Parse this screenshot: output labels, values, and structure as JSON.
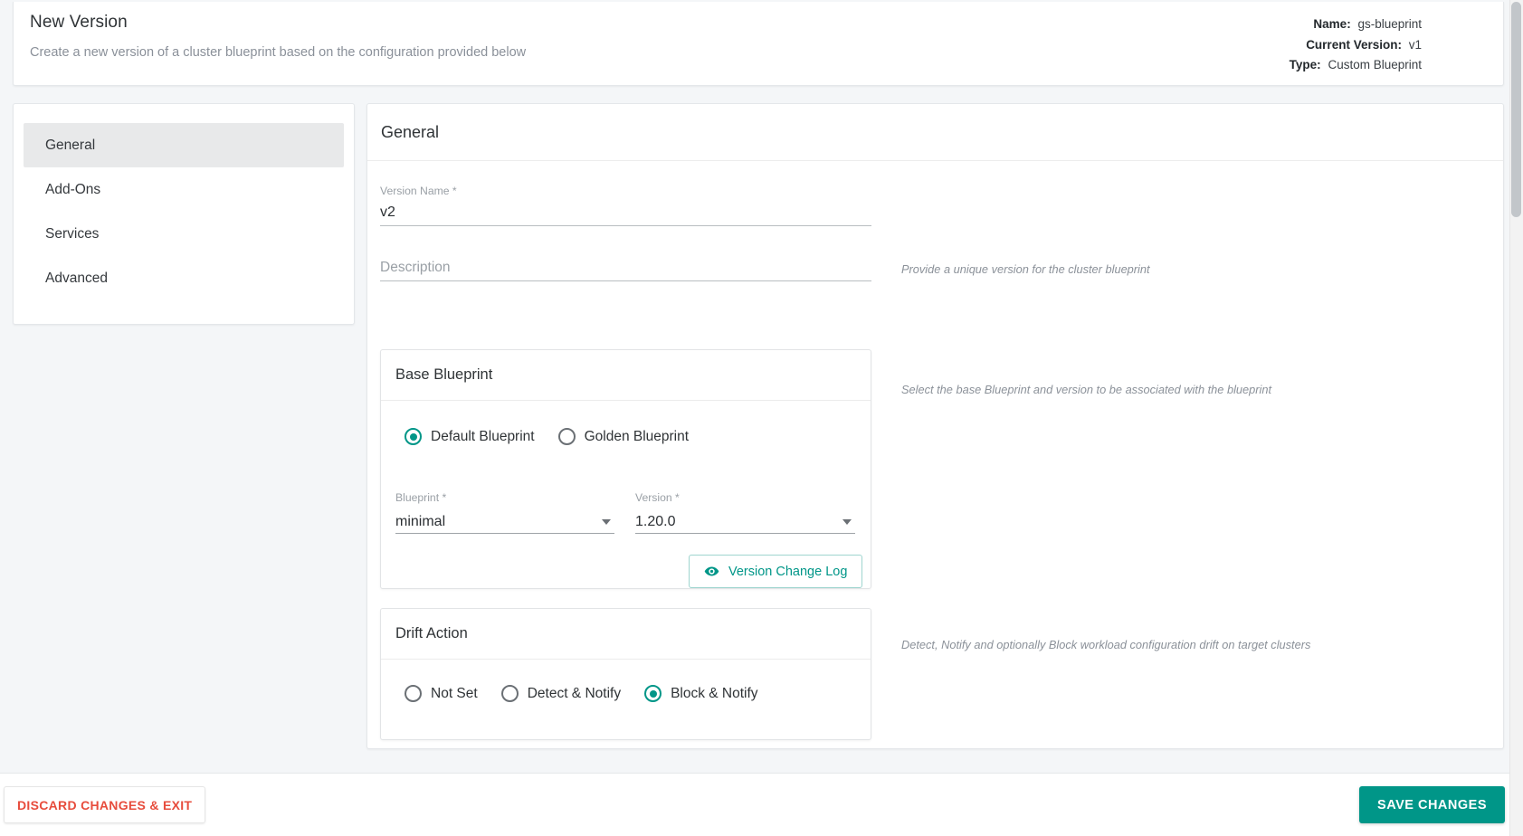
{
  "header": {
    "title": "New Version",
    "subtitle": "Create a new version of a cluster blueprint based on the configuration provided below",
    "meta": [
      {
        "key": "Name:",
        "value": "gs-blueprint"
      },
      {
        "key": "Current Version:",
        "value": "v1"
      },
      {
        "key": "Type:",
        "value": "Custom Blueprint"
      }
    ]
  },
  "sidebar": {
    "items": [
      {
        "label": "General",
        "active": true
      },
      {
        "label": "Add-Ons",
        "active": false
      },
      {
        "label": "Services",
        "active": false
      },
      {
        "label": "Advanced",
        "active": false
      }
    ]
  },
  "main": {
    "section_title": "General",
    "version_name": {
      "label": "Version Name *",
      "value": "v2",
      "hint": "Provide a unique version for the cluster blueprint"
    },
    "description": {
      "label": "Description",
      "placeholder": "Description",
      "value": ""
    },
    "base_blueprint": {
      "title": "Base Blueprint",
      "hint": "Select the base Blueprint and version to be associated with the blueprint",
      "options": [
        {
          "label": "Default Blueprint",
          "selected": true
        },
        {
          "label": "Golden Blueprint",
          "selected": false
        }
      ],
      "blueprint_select": {
        "label": "Blueprint *",
        "value": "minimal"
      },
      "version_select": {
        "label": "Version *",
        "value": "1.20.0"
      },
      "change_log_button": "Version Change Log"
    },
    "drift_action": {
      "title": "Drift Action",
      "hint": "Detect, Notify and optionally Block workload configuration drift on target clusters",
      "options": [
        {
          "label": "Not Set",
          "selected": false
        },
        {
          "label": "Detect & Notify",
          "selected": false
        },
        {
          "label": "Block & Notify",
          "selected": true
        }
      ]
    }
  },
  "footer": {
    "discard_label": "DISCARD CHANGES & EXIT",
    "save_label": "SAVE CHANGES"
  },
  "colors": {
    "accent": "#009688",
    "danger": "#e74c3c",
    "page_bg": "#f4f6f8"
  }
}
